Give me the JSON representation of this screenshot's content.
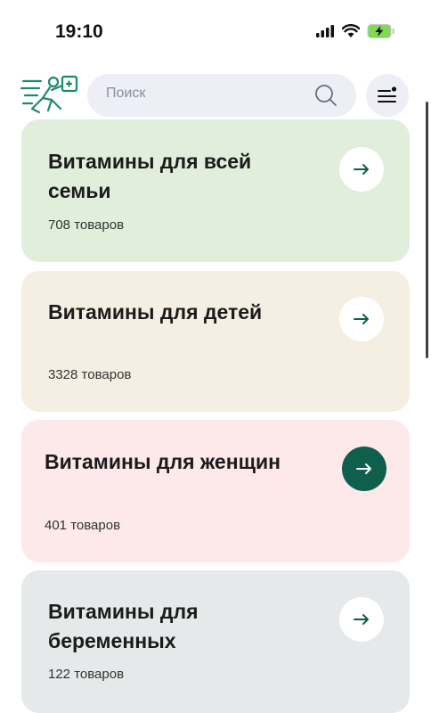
{
  "status_bar": {
    "time": "19:10"
  },
  "header": {
    "search_placeholder": "Поиск"
  },
  "categories": [
    {
      "title": "Витамины для всей семьи",
      "count": "708 товаров",
      "bg": "#e1eedb",
      "active": false
    },
    {
      "title": "Витамины для детей",
      "count": "3328 товаров",
      "bg": "#f5efe3",
      "active": false
    },
    {
      "title": "Витамины для женщин",
      "count": "401 товаров",
      "bg": "#fde8ea",
      "active": true
    },
    {
      "title": "Витамины для беременных",
      "count": "122 товаров",
      "bg": "#e6e9e9",
      "active": false
    }
  ],
  "colors": {
    "accent": "#0e5f4c",
    "search_bg": "#eeeef6"
  },
  "icons": [
    "logo-icon",
    "search-icon",
    "menu-icon",
    "arrow-right-icon",
    "signal-icon",
    "wifi-icon",
    "battery-icon"
  ]
}
